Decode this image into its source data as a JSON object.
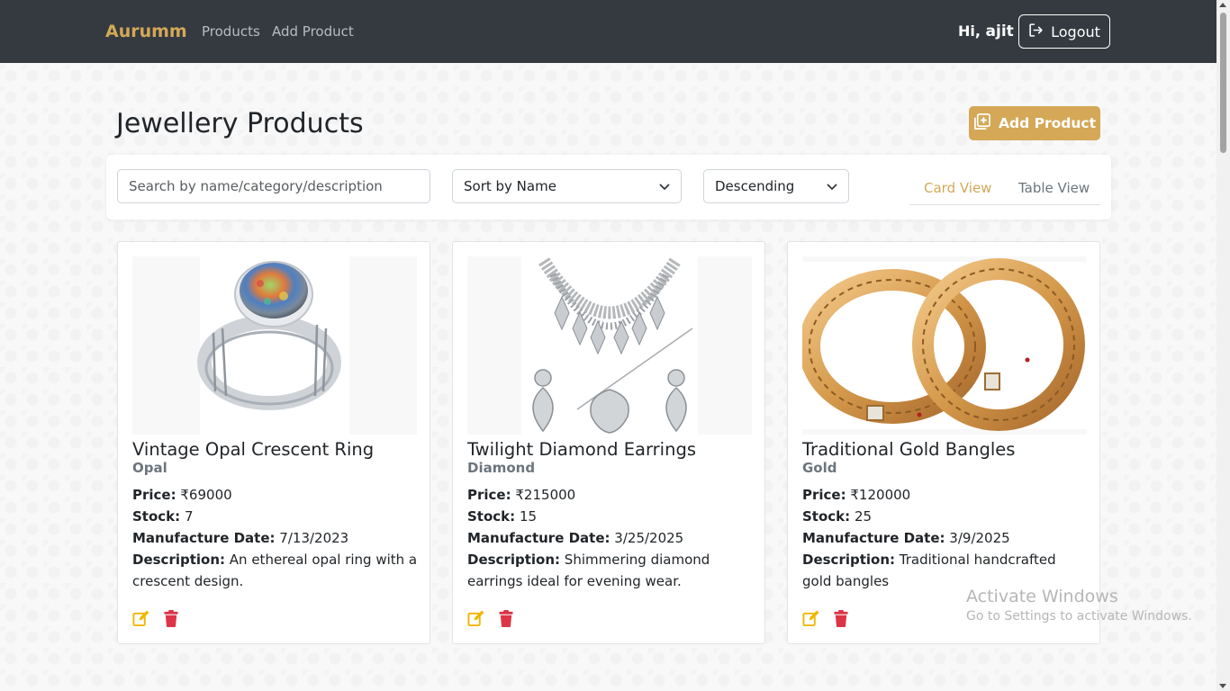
{
  "navbar": {
    "brand": "Aurumm",
    "links": [
      "Products",
      "Add Product"
    ],
    "greeting_prefix": "Hi,",
    "username": "ajit",
    "logout_label": "Logout"
  },
  "page": {
    "title": "Jewellery Products",
    "add_button_label": "Add Product"
  },
  "toolbar": {
    "search_placeholder": "Search by name/category/description",
    "sort_by": "Sort by Name",
    "order": "Descending",
    "tabs": [
      {
        "label": "Card View",
        "active": true
      },
      {
        "label": "Table View",
        "active": false
      }
    ]
  },
  "labels": {
    "price": "Price:",
    "stock": "Stock:",
    "date": "Manufacture Date:",
    "description": "Description:"
  },
  "products": [
    {
      "name": "Vintage Opal Crescent Ring",
      "category": "Opal",
      "price": "₹69000",
      "stock": "7",
      "date": "7/13/2023",
      "description": "An ethereal opal ring with a crescent design."
    },
    {
      "name": "Twilight Diamond Earrings",
      "category": "Diamond",
      "price": "₹215000",
      "stock": "15",
      "date": "3/25/2025",
      "description": "Shimmering diamond earrings ideal for evening wear."
    },
    {
      "name": "Traditional Gold Bangles",
      "category": "Gold",
      "price": "₹120000",
      "stock": "25",
      "date": "3/9/2025",
      "description": "Traditional handcrafted gold bangles"
    }
  ],
  "watermark": {
    "line1": "Activate Windows",
    "line2": "Go to Settings to activate Windows."
  },
  "colors": {
    "navbar": "#343a40",
    "accent": "#d4a857",
    "edit": "#f2b600",
    "delete": "#dc3545"
  }
}
